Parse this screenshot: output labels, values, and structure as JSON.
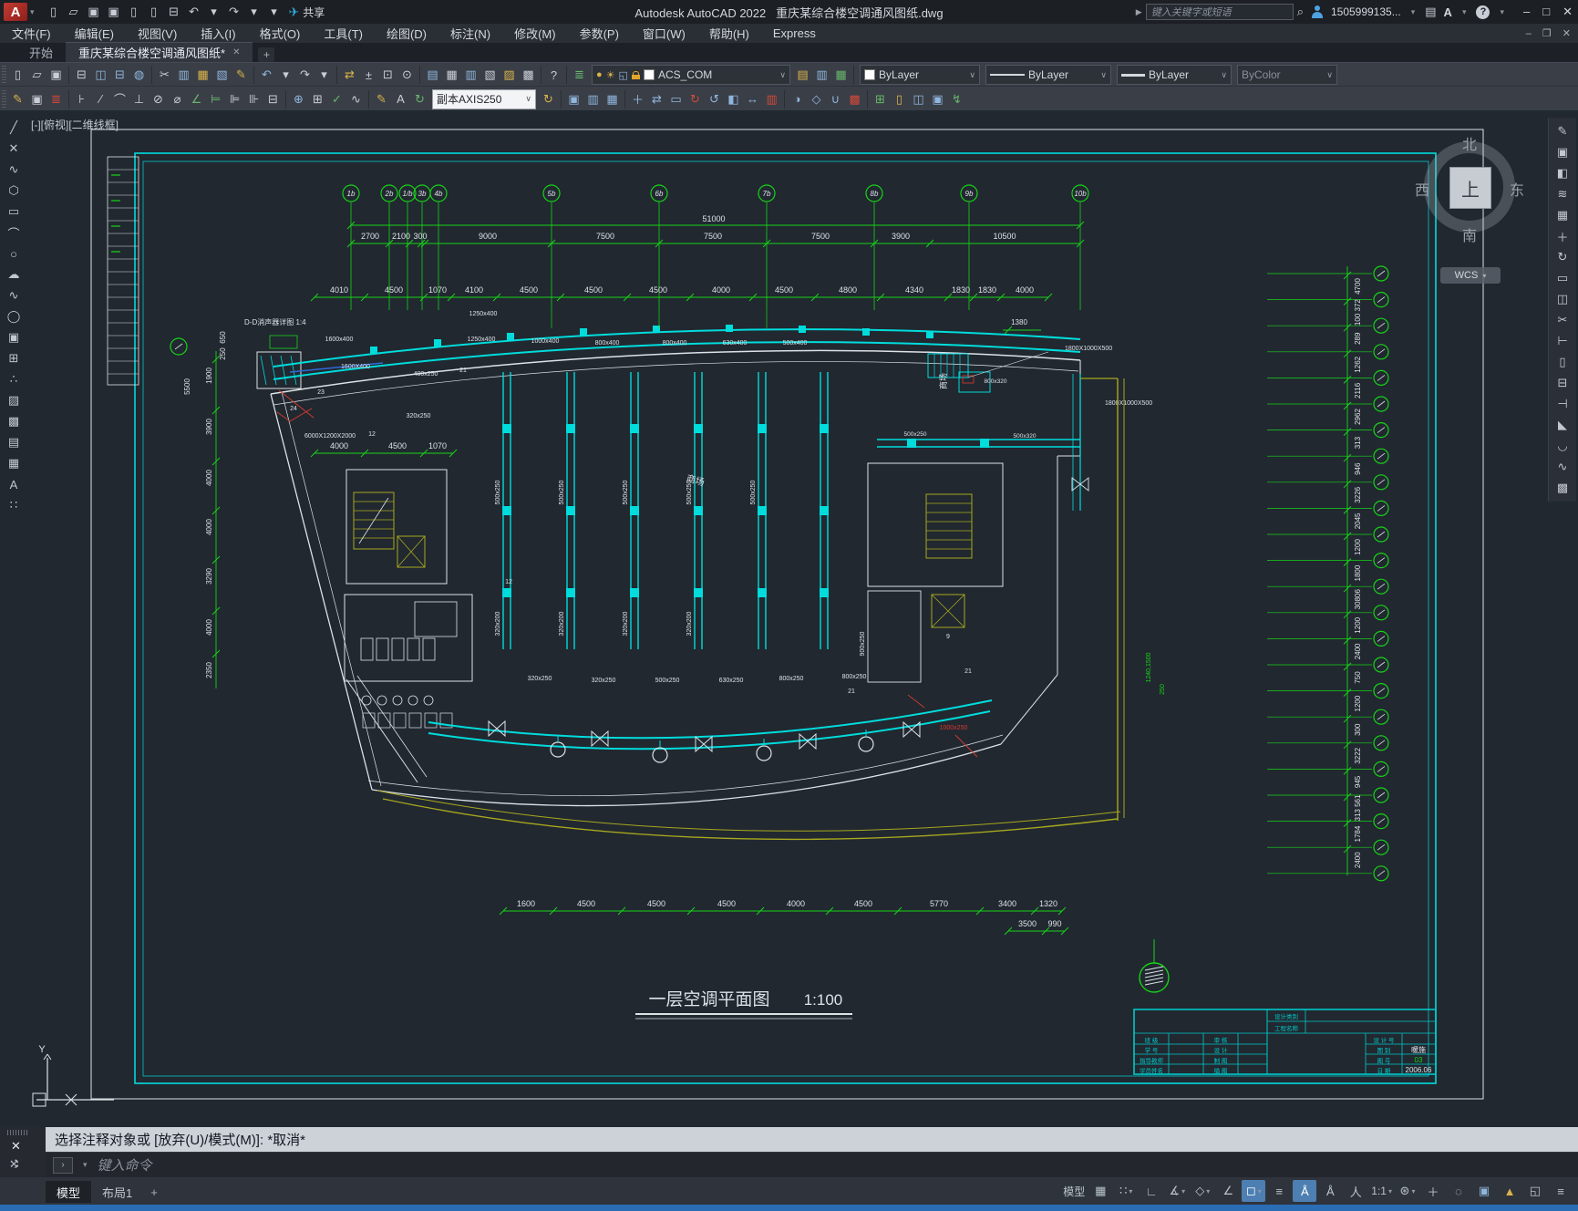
{
  "title_bar": {
    "app_logo": "A",
    "app_title": "Autodesk AutoCAD 2022",
    "doc_title": "重庆某综合楼空调通风图纸.dwg",
    "share_label": "共享",
    "search_placeholder": "键入关键字或短语",
    "account_id": "1505999135...",
    "min_glyph": "–",
    "max_glyph": "□",
    "close_glyph": "✕",
    "doc_min": "–",
    "doc_restore": "❐",
    "doc_close": "✕",
    "help_glyph": "?"
  },
  "menu_bar": {
    "items": [
      "文件(F)",
      "编辑(E)",
      "视图(V)",
      "插入(I)",
      "格式(O)",
      "工具(T)",
      "绘图(D)",
      "标注(N)",
      "修改(M)",
      "参数(P)",
      "窗口(W)",
      "帮助(H)",
      "Express"
    ]
  },
  "file_tabs": {
    "start_tab": "开始",
    "doc_tab": "重庆某综合楼空调通风图纸*",
    "close_glyph": "✕",
    "new_tab_glyph": "+"
  },
  "toolbars": {
    "layer_value": "ACS_COM",
    "color_value": "ByLayer",
    "linetype_value": "ByLayer",
    "lineweight_value": "ByLayer",
    "plotstyle_value": "ByColor",
    "dimstyle_value": "副本AXIS250"
  },
  "icons": {
    "qat": [
      {
        "n": "new-file-icon",
        "g": "▯"
      },
      {
        "n": "open-file-icon",
        "g": "▱"
      },
      {
        "n": "save-icon",
        "g": "▣"
      },
      {
        "n": "save-as-icon",
        "g": "▣",
        "c": "itY"
      },
      {
        "n": "open-from-mobile-icon",
        "g": "▯",
        "c": "itB"
      },
      {
        "n": "save-to-mobile-icon",
        "g": "▯",
        "c": "itG"
      },
      {
        "n": "plot-icon",
        "g": "⊟"
      },
      {
        "n": "undo-icon",
        "g": "↶",
        "c": "itB"
      },
      {
        "n": "undo-menu-icon",
        "g": "▾"
      },
      {
        "n": "redo-icon",
        "g": "↷"
      },
      {
        "n": "redo-menu-icon",
        "g": "▾"
      },
      {
        "n": "qat-customize-icon",
        "g": "▾"
      }
    ],
    "tb1": [
      {
        "n": "new-icon",
        "g": "▯"
      },
      {
        "n": "open-icon",
        "g": "▱"
      },
      {
        "n": "save-icon",
        "g": "▣"
      },
      {
        "n": "sep"
      },
      {
        "n": "print-icon",
        "g": "⊟"
      },
      {
        "n": "print-preview-icon",
        "g": "◫",
        "c": "itB"
      },
      {
        "n": "plot-icon",
        "g": "⊟",
        "c": "itB"
      },
      {
        "n": "publish-icon",
        "g": "◍",
        "c": "itB"
      },
      {
        "n": "sep"
      },
      {
        "n": "cut-icon",
        "g": "✂"
      },
      {
        "n": "copy-icon",
        "g": "▥",
        "c": "itB"
      },
      {
        "n": "paste-icon",
        "g": "▦",
        "c": "itY"
      },
      {
        "n": "match-properties-icon",
        "g": "▧",
        "c": "itB"
      },
      {
        "n": "block-edit-icon",
        "g": "✎",
        "c": "itY"
      },
      {
        "n": "sep"
      },
      {
        "n": "undo-icon",
        "g": "↶",
        "c": "itB"
      },
      {
        "n": "undo-menu-icon",
        "g": "▾"
      },
      {
        "n": "redo-icon",
        "g": "↷"
      },
      {
        "n": "redo-menu-icon",
        "g": "▾"
      },
      {
        "n": "sep"
      },
      {
        "n": "pan-icon",
        "g": "⇄",
        "c": "itY"
      },
      {
        "n": "zoom-realtime-icon",
        "g": "±"
      },
      {
        "n": "zoom-window-icon",
        "g": "⊡"
      },
      {
        "n": "zoom-previous-icon",
        "g": "⊙"
      },
      {
        "n": "sep"
      },
      {
        "n": "properties-palette-icon",
        "g": "▤",
        "c": "itB"
      },
      {
        "n": "design-center-icon",
        "g": "▦"
      },
      {
        "n": "tool-palettes-icon",
        "g": "▥",
        "c": "itB"
      },
      {
        "n": "sheet-set-icon",
        "g": "▧"
      },
      {
        "n": "markup-icon",
        "g": "▨",
        "c": "itY"
      },
      {
        "n": "quickcalc-icon",
        "g": "▩"
      },
      {
        "n": "sep"
      },
      {
        "n": "help-icon",
        "g": "?"
      },
      {
        "n": "sep"
      },
      {
        "n": "layer-states-icon",
        "g": "≣",
        "c": "itG"
      }
    ],
    "tb1b": [
      {
        "n": "layer-off-icon",
        "g": "▤",
        "c": "itY"
      },
      {
        "n": "layer-isolate-icon",
        "g": "▥",
        "c": "itB"
      },
      {
        "n": "layer-freeze-icon",
        "g": "▦",
        "c": "itG"
      }
    ],
    "tb2": [
      {
        "n": "dim-style-icon",
        "g": "✎",
        "c": "itY"
      },
      {
        "n": "text-style-icon",
        "g": "▣"
      },
      {
        "n": "layer-translate-icon",
        "g": "≣",
        "c": "itR"
      },
      {
        "n": "sep"
      },
      {
        "n": "linear-dim-icon",
        "g": "⊦"
      },
      {
        "n": "aligned-dim-icon",
        "g": "∕"
      },
      {
        "n": "arc-length-dim-icon",
        "g": "⌒"
      },
      {
        "n": "ordinate-dim-icon",
        "g": "⊥"
      },
      {
        "n": "radius-dim-icon",
        "g": "⊘"
      },
      {
        "n": "diameter-dim-icon",
        "g": "⌀"
      },
      {
        "n": "angular-dim-icon",
        "g": "∠",
        "c": "itG"
      },
      {
        "n": "quick-dim-icon",
        "g": "⊨",
        "c": "itG"
      },
      {
        "n": "baseline-dim-icon",
        "g": "⊫"
      },
      {
        "n": "continue-dim-icon",
        "g": "⊪"
      },
      {
        "n": "dim-break-icon",
        "g": "⊟"
      },
      {
        "n": "sep"
      },
      {
        "n": "center-mark-icon",
        "g": "⊕",
        "c": "itB"
      },
      {
        "n": "tolerance-icon",
        "g": "⊞"
      },
      {
        "n": "inspect-dim-icon",
        "g": "✓",
        "c": "itG"
      },
      {
        "n": "jogged-dim-icon",
        "g": "∿"
      },
      {
        "n": "sep"
      },
      {
        "n": "dim-edit-icon",
        "g": "✎",
        "c": "itY"
      },
      {
        "n": "dim-text-edit-icon",
        "g": "A"
      },
      {
        "n": "dim-update-icon",
        "g": "↻",
        "c": "itG"
      }
    ],
    "tb2b": [
      {
        "n": "dim-update-icon",
        "g": "↻",
        "c": "itY"
      },
      {
        "n": "sep"
      },
      {
        "n": "copy-solid-icon",
        "g": "▣",
        "c": "itB"
      },
      {
        "n": "paste-solid-icon",
        "g": "▥",
        "c": "itB"
      },
      {
        "n": "block-solid-icon",
        "g": "▦",
        "c": "itB"
      },
      {
        "n": "sep"
      },
      {
        "n": "move-icon",
        "g": "＋",
        "c": "itB"
      },
      {
        "n": "pan-drag-icon",
        "g": "⇄",
        "c": "itB"
      },
      {
        "n": "rect-select-icon",
        "g": "▭",
        "c": "itB"
      },
      {
        "n": "rotate-icon",
        "g": "↻",
        "c": "itR"
      },
      {
        "n": "rotate-ccw-icon",
        "g": "↺",
        "c": "itB"
      },
      {
        "n": "mirror-solid-icon",
        "g": "◧",
        "c": "itB"
      },
      {
        "n": "stretch-icon",
        "g": "↔",
        "c": "itB"
      },
      {
        "n": "align-icon",
        "g": "▥",
        "c": "itR"
      },
      {
        "n": "sep"
      },
      {
        "n": "wedge-icon",
        "g": "◑",
        "c": "itB"
      },
      {
        "n": "slice-icon",
        "g": "◇",
        "c": "itB"
      },
      {
        "n": "union-icon",
        "g": "∪",
        "c": "itB"
      },
      {
        "n": "subtract-icon",
        "g": "▩",
        "c": "itR"
      },
      {
        "n": "sep"
      },
      {
        "n": "extrude-icon",
        "g": "⊞",
        "c": "itG"
      },
      {
        "n": "sweep-icon",
        "g": "▯",
        "c": "itY"
      },
      {
        "n": "loft-icon",
        "g": "◫",
        "c": "itB"
      },
      {
        "n": "revolve-icon",
        "g": "▣",
        "c": "itB"
      },
      {
        "n": "helix-icon",
        "g": "↯",
        "c": "itG"
      }
    ],
    "left_tools": [
      {
        "n": "line-tool-icon",
        "g": "╱"
      },
      {
        "n": "xline-tool-icon",
        "g": "✕"
      },
      {
        "n": "polyline-tool-icon",
        "g": "∿"
      },
      {
        "n": "polygon-tool-icon",
        "g": "⬡"
      },
      {
        "n": "rectangle-tool-icon",
        "g": "▭"
      },
      {
        "n": "arc-tool-icon",
        "g": "⌒"
      },
      {
        "n": "circle-tool-icon",
        "g": "○"
      },
      {
        "n": "revcloud-tool-icon",
        "g": "☁"
      },
      {
        "n": "spline-tool-icon",
        "g": "∿"
      },
      {
        "n": "ellipse-tool-icon",
        "g": "◯"
      },
      {
        "n": "insert-block-tool-icon",
        "g": "▣"
      },
      {
        "n": "make-block-tool-icon",
        "g": "⊞"
      },
      {
        "n": "point-tool-icon",
        "g": "∴"
      },
      {
        "n": "hatch-tool-icon",
        "g": "▨"
      },
      {
        "n": "gradient-tool-icon",
        "g": "▩"
      },
      {
        "n": "region-tool-icon",
        "g": "▤"
      },
      {
        "n": "table-tool-icon",
        "g": "▦"
      },
      {
        "n": "text-tool-icon",
        "g": "A"
      },
      {
        "n": "addselect-tool-icon",
        "g": "∷",
        "c": "itG"
      }
    ],
    "right_tools": [
      {
        "n": "erase-tool-icon",
        "g": "✎",
        "c": "itR"
      },
      {
        "n": "copy-tool-icon",
        "g": "▣",
        "c": "itB"
      },
      {
        "n": "mirror-tool-icon",
        "g": "◧",
        "c": "itB"
      },
      {
        "n": "offset-tool-icon",
        "g": "≋"
      },
      {
        "n": "array-tool-icon",
        "g": "▦",
        "c": "itB"
      },
      {
        "n": "move-tool-icon",
        "g": "＋"
      },
      {
        "n": "rotate-tool-icon",
        "g": "↻"
      },
      {
        "n": "scale-tool-icon",
        "g": "▭"
      },
      {
        "n": "copy-nested-icon",
        "g": "◫",
        "c": "itB"
      },
      {
        "n": "trim-tool-icon",
        "g": "✂"
      },
      {
        "n": "extend-tool-icon",
        "g": "⊢"
      },
      {
        "n": "break-point-icon",
        "g": "▯"
      },
      {
        "n": "break-tool-icon",
        "g": "⊟"
      },
      {
        "n": "join-tool-icon",
        "g": "⊣"
      },
      {
        "n": "chamfer-tool-icon",
        "g": "◣"
      },
      {
        "n": "fillet-tool-icon",
        "g": "◡"
      },
      {
        "n": "blend-tool-icon",
        "g": "∿"
      },
      {
        "n": "explode-tool-icon",
        "g": "▩",
        "c": "itB"
      }
    ],
    "status": [
      {
        "n": "model-paper-toggle",
        "t": "模型"
      },
      {
        "n": "grid-display-icon",
        "g": "▦"
      },
      {
        "n": "snap-mode-icon",
        "g": "∷",
        "v": true
      },
      {
        "n": "ortho-mode-icon",
        "g": "∟"
      },
      {
        "n": "polar-tracking-icon",
        "g": "∡",
        "v": true
      },
      {
        "n": "isodraft-icon",
        "g": "◇",
        "v": true
      },
      {
        "n": "object-snap-tracking-icon",
        "g": "∠"
      },
      {
        "n": "object-snap-icon",
        "g": "◻",
        "on": true,
        "v": true
      },
      {
        "n": "lineweight-display-icon",
        "g": "≡"
      },
      {
        "n": "annotation-visibility-icon",
        "g": "Å",
        "on": true
      },
      {
        "n": "auto-annotation-scale-icon",
        "g": "Å"
      },
      {
        "n": "annotation-scale-icon",
        "g": "人"
      },
      {
        "n": "annotation-scale-value",
        "t": "1:1",
        "v": true
      },
      {
        "n": "workspace-switch-icon",
        "g": "⊛",
        "v": true
      },
      {
        "n": "crosshair-icon",
        "g": "＋"
      },
      {
        "n": "isolate-objects-icon",
        "g": "◌"
      },
      {
        "n": "graphics-performance-icon",
        "g": "▣",
        "c": "itB"
      },
      {
        "n": "trusted-dwg-warning-icon",
        "g": "▲",
        "c": "itY"
      },
      {
        "n": "clean-screen-icon",
        "g": "◱"
      },
      {
        "n": "customize-status-icon",
        "g": "≡"
      }
    ]
  },
  "canvas": {
    "viewport_label": "[-][俯视][二维线框]",
    "compass": {
      "north": "北",
      "south": "南",
      "east": "东",
      "west": "西",
      "top": "上",
      "wcs": "WCS",
      "wcs_chevron": "▾"
    }
  },
  "drawing": {
    "title": "一层空调平面图",
    "scale": "1:100",
    "grid_total": "51000",
    "grid_bubbles": [
      "1b",
      "2b",
      "1/b",
      "3b",
      "4b",
      "5b",
      "6b",
      "7b",
      "8b",
      "9b",
      "10b"
    ],
    "grid_dims": [
      "2700",
      "2100",
      "300",
      "9000",
      "7500",
      "7500",
      "7500",
      "3900",
      "10500"
    ],
    "dims_row2": [
      "4010",
      "4500",
      "1070",
      "4100",
      "4500",
      "4500",
      "4500",
      "4000",
      "4500",
      "4800",
      "4340",
      "1830",
      "1830",
      "4000"
    ],
    "dims_mid": [
      "4000",
      "4500",
      "1070"
    ],
    "dims_bottom": [
      "1600",
      "4500",
      "4500",
      "4500",
      "4000",
      "4500",
      "5770",
      "3400",
      "1320"
    ],
    "dims_bottom2": [
      "3500",
      "990"
    ],
    "right_dims": [
      "4700",
      "100 372",
      "289",
      "1262",
      "2116",
      "2962",
      "313",
      "946",
      "3226",
      "2045",
      "1200",
      "1800",
      "30806",
      "1200",
      "2400",
      "750",
      "1200",
      "300",
      "3222",
      "945",
      "313 561",
      "1784",
      "2400"
    ],
    "left_dims": [
      "650",
      "250",
      "5500",
      "1900",
      "3900",
      "4000",
      "4000",
      "3290",
      "4000",
      "2350"
    ],
    "duct_labels_top": [
      "1250x400",
      "1250x400",
      "1600x400",
      "1600X400",
      "1000x400",
      "800x400",
      "800x400",
      "630x400",
      "500x400"
    ],
    "duct_labels_vert": [
      "500x250",
      "500x250",
      "500x250",
      "500x250",
      "500x250"
    ],
    "duct_labels_vert2": [
      "320x200",
      "320x200",
      "320x200",
      "320x200"
    ],
    "duct_labels_bottom": [
      "320x250",
      "320x250",
      "500x250",
      "630x250",
      "800x250",
      "800x250",
      "900x250"
    ],
    "ann_detail": "D-D消声器详图 1:4",
    "ann_unit": "6000X1200X2000",
    "ann_400x250": "400x250",
    "ann_320x250": "320x250",
    "ann_1380": "1380",
    "ann_ahu1": "1800X1000X500",
    "ann_ahu2": "1800X1000X500",
    "ann_800x320": "800x320",
    "ann_500x320": "500x320",
    "ann_500x250": "500x250",
    "ann_red_duct": "1000x250",
    "ann_1240": "1240,1500",
    "ann_250": "250",
    "ann_mall1": "商场",
    "ann_mall2": "商场",
    "small_indices": [
      "12",
      "21",
      "23",
      "24",
      "12",
      "21",
      "9",
      "21"
    ],
    "ucs_y_label": "Y",
    "title_block": {
      "rows_left": [
        "班  级",
        "学  号",
        "指导教师",
        "学员姓名"
      ],
      "rows_mid": [
        "审  核",
        "设  计",
        "制  图",
        "描  图"
      ],
      "label_category": "设计类别",
      "label_project": "工程名称",
      "rows_right": [
        "设 计 号",
        "图  别",
        "图  号",
        "日  期"
      ],
      "values_right": [
        "",
        "暖施",
        "03",
        "2006.06"
      ]
    }
  },
  "command": {
    "history": "选择注释对象或 [放弃(U)/模式(M)]: *取消*",
    "input_placeholder": "键入命令",
    "gutter_close": "✕",
    "prompt_glyph": "›"
  },
  "layout_tabs": {
    "model": "模型",
    "layout1": "布局1",
    "add": "+"
  },
  "colors": {
    "cad_green": "#17d417",
    "cad_cyan": "#00dcdc",
    "cad_white": "#dde2e7",
    "cad_yellow": "#a8a81e",
    "cad_red": "#d83b30",
    "cad_blue": "#2e6bd8",
    "tb_cyan": "#00c8c8"
  }
}
